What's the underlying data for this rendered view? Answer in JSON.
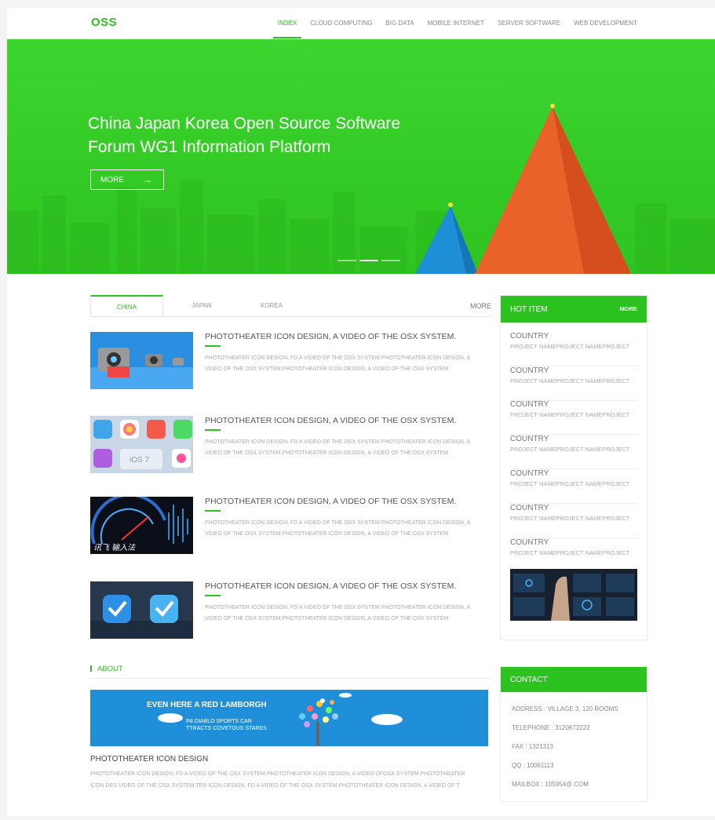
{
  "header": {
    "logo": "OSS",
    "nav": [
      "INDEX",
      "CLOUD COMPUTING",
      "BIG DATA",
      "MOBILE INTERNET",
      "SERVER SOFTWARE",
      "WEB DEVELOPMENT"
    ]
  },
  "banner": {
    "title_line1": "China Japan Korea  Open Source Software",
    "title_line2": "Forum  WG1  Information Platform",
    "more_label": "MORE",
    "arrow": "→"
  },
  "tabs": {
    "items": [
      "CHINA",
      "JAPAN",
      "KOREA"
    ],
    "more": "MORE"
  },
  "articles": [
    {
      "title": "PHOTOTHEATER ICON DESIGN, A VIDEO OF THE OSX SYSTEM.",
      "desc": "PHOTOTHEATER ICON DESIGN,     FD A VIDEO OF THE OSX SYSTEM.PHOTOTHEATER ICON DESIGN, A VIDEO OF THE OSX SYSTEM.PHOTOTHEATER ICON DESIGN, A VIDEO OF THE OSX SYSTEM"
    },
    {
      "title": "PHOTOTHEATER ICON DESIGN, A VIDEO OF THE OSX SYSTEM.",
      "desc": "PHOTOTHEATER ICON DESIGN,     FD A VIDEO OF THE OSX SYSTEM.PHOTOTHEATER ICON DESIGN, A VIDEO OF THE OSX SYSTEM.PHOTOTHEATER ICON DESIGN, A VIDEO OF THE OSX SYSTEM"
    },
    {
      "title": "PHOTOTHEATER ICON DESIGN, A VIDEO OF THE OSX SYSTEM.",
      "desc": "PHOTOTHEATER ICON DESIGN,     FD A VIDEO OF THE OSX SYSTEM.PHOTOTHEATER ICON DESIGN, A VIDEO OF THE OSX SYSTEM.PHOTOTHEATER ICON DESIGN, A VIDEO OF THE OSX SYSTEM"
    },
    {
      "title": "PHOTOTHEATER ICON DESIGN, A VIDEO OF THE OSX SYSTEM.",
      "desc": "PHOTOTHEATER ICON DESIGN,     FD A VIDEO OF THE OSX SYSTEM.PHOTOTHEATER ICON DESIGN, A VIDEO OF THE OSX SYSTEM.PHOTOTHEATER ICON DESIGN, A VIDEO OF THE OSX SYSTEM"
    }
  ],
  "thumb_text": {
    "ios": "iOS 7",
    "brand": "讯飞 输入法"
  },
  "about": {
    "heading": "ABOUT",
    "banner_headline": "EVEN HERE A RED LAMBORGH",
    "banner_sub1": "INI DIABLO SPORTS CAR",
    "banner_sub2": "TTRACTS COVETOUS STARES",
    "title": "PHOTOTHEATER ICON DESIGN",
    "desc": "PHOTOTHEATER ICON DESIGN,     FD A VIDEO OF THE OSX SYSTEM.PHOTOTHEATER ICON DESIGN, A VIDEO OFOSX SYSTEM.PHOTOTHEATER ICON DES VIDEO OF THE OSX SYSTEM.TER ICON DESIGN,     FD A VIDEO OF THE OSX SYSTEM.PHOTOTHEATER ICON DESIGN, A VIDEO OF T"
  },
  "hot": {
    "heading": "HOT ITEM",
    "more": "MORE",
    "items": [
      {
        "country": "COUNTRY",
        "project": "PROJECT NAMEPROJECT NAMEPROJECT"
      },
      {
        "country": "COUNTRY",
        "project": "PROJECT NAMEPROJECT NAMEPROJECT"
      },
      {
        "country": "COUNTRY",
        "project": "PROJECT NAMEPROJECT NAMEPROJECT"
      },
      {
        "country": "COUNTRY",
        "project": "PROJECT NAMEPROJECT NAMEPROJECT"
      },
      {
        "country": "COUNTRY",
        "project": "PROJECT NAMEPROJECT NAMEPROJECT"
      },
      {
        "country": "COUNTRY",
        "project": "PROJECT NAMEPROJECT NAMEPROJECT"
      },
      {
        "country": "COUNTRY",
        "project": "PROJECT NAMEPROJECT NAMEPROJECT"
      }
    ]
  },
  "contact": {
    "heading": "CONTACT",
    "address": "ADDRESS :    VILLAGE 3, 120 ROOMS",
    "telephone": "TELEPHONE : 3120672222",
    "fax": "FAX : 1321313",
    "qq": "QQ : 10061113",
    "mailbox": "MAILBOX : 105954@.COM"
  },
  "colors": {
    "accent": "#2cc21f",
    "pyramid_orange": "#e8622a",
    "pyramid_blue": "#1e8fd6"
  }
}
